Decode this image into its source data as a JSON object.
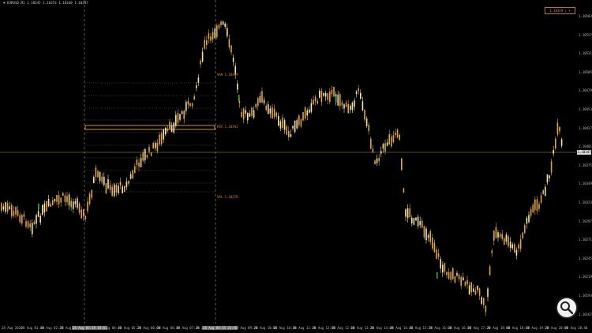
{
  "header": {
    "symbol_info": "▼ EURUSD,M1  1.10345 1.10353 1.10340 1.10347",
    "badge": "1.10349 ▴ ▾"
  },
  "price_axis": {
    "ticks": [
      "1.10583",
      "1.10557",
      "1.10531",
      "1.10505",
      "1.10479",
      "1.10453",
      "1.10427",
      "1.10401",
      "1.10375",
      "1.10349",
      "1.10323",
      "1.10297",
      "1.10271",
      "1.10245",
      "1.10219",
      "1.10193",
      "1.10167"
    ],
    "current_price": "1.10347"
  },
  "time_axis": {
    "labels": [
      "28 Aug 2020",
      "28 Aug 01:40",
      "28 Aug 02:20",
      "28 Aug 03:00",
      "28 Aug 04:00",
      "28 Aug 04:40",
      "28 Aug 05:20",
      "28 Aug 06:00",
      "28 Aug 06:40",
      "28 Aug 07:20",
      "28 Aug 08:00",
      "28 Aug 08:40",
      "28 Aug 09:20",
      "28 Aug 10:00",
      "28 Aug 10:40",
      "28 Aug 11:20",
      "28 Aug 12:00",
      "28 Aug 12:40",
      "28 Aug 13:20",
      "28 Aug 14:00",
      "28 Aug 14:40",
      "28 Aug 15:20",
      "28 Aug 16:00",
      "28 Aug 16:40",
      "28 Aug 17:20",
      "28 Aug 18:00",
      "28 Aug 18:40",
      "28 Aug 19:20",
      "28 Aug 20:00",
      "28 Aug 20:40"
    ],
    "highlight_left": "28 Aug 03:18 18:01",
    "highlight_right": "28 Aug 04:35 26:46"
  },
  "levels": {
    "vah": "VAH 1.10449",
    "poc": "POC 1.10392",
    "val": "VAL 1.10278"
  },
  "colors": {
    "background": "#000000",
    "bull": "#f4e4b0",
    "bear": "#e0a54a",
    "profile": "#e0a54a",
    "grid_line": "#777777"
  },
  "icons": {
    "zoom": "magnifier-icon"
  }
}
